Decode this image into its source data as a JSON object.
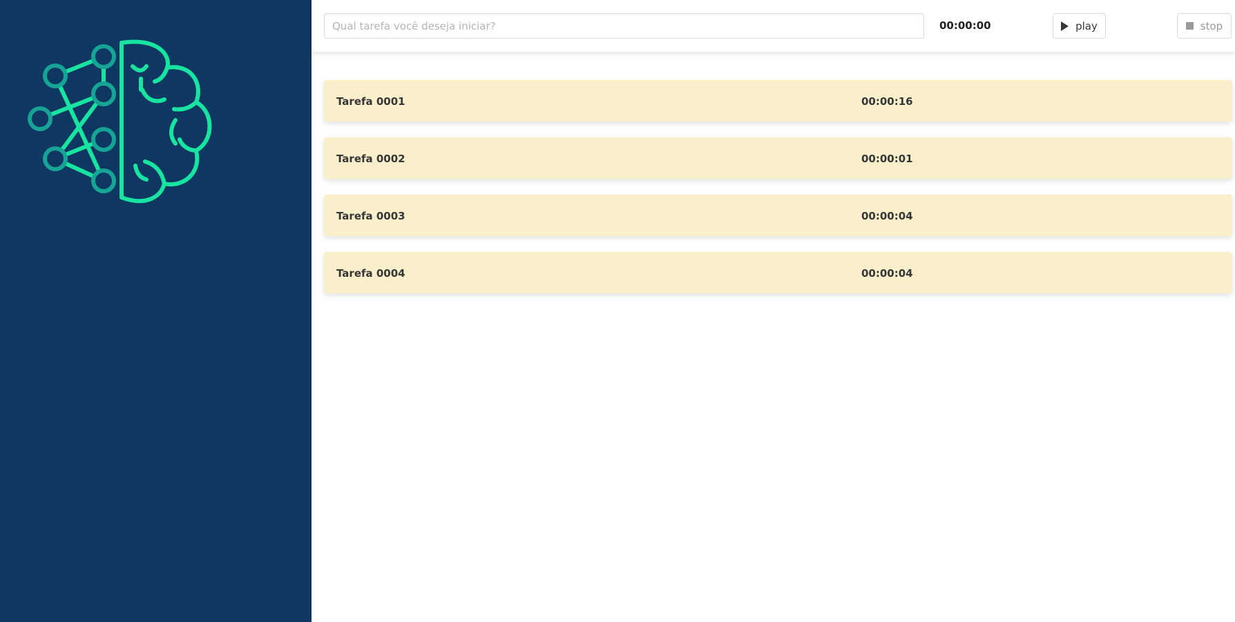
{
  "sidebar": {
    "logo_icon": "brain-network-icon",
    "colors": {
      "background": "#0e3861",
      "logo_green": "#19e3a0",
      "logo_teal": "#17a396"
    }
  },
  "topbar": {
    "input": {
      "placeholder": "Qual tarefa você deseja iniciar?",
      "value": ""
    },
    "timer": "00:00:00",
    "play_label": "play",
    "play_icon": "play-icon",
    "stop_label": "stop",
    "stop_icon": "stop-icon"
  },
  "tasks": [
    {
      "name": "Tarefa 0001",
      "time": "00:00:16"
    },
    {
      "name": "Tarefa 0002",
      "time": "00:00:01"
    },
    {
      "name": "Tarefa 0003",
      "time": "00:00:04"
    },
    {
      "name": "Tarefa 0004",
      "time": "00:00:04"
    }
  ],
  "colors": {
    "task_background": "#f9efcb"
  }
}
